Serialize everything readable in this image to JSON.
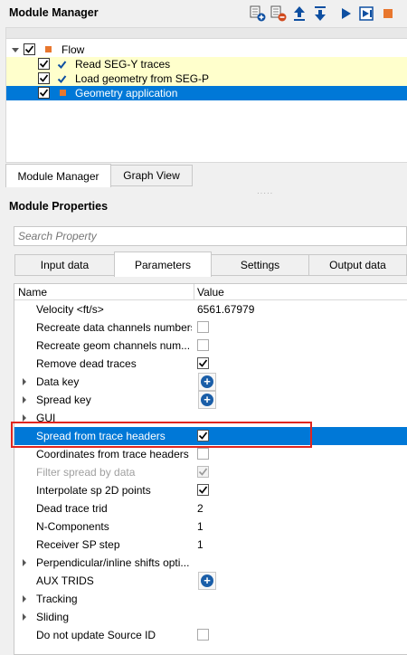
{
  "module_manager": {
    "title": "Module Manager",
    "toolbar": [
      {
        "name": "add-module-icon",
        "color": "#0e4fa1"
      },
      {
        "name": "remove-module-icon",
        "color": "#d04a1e"
      },
      {
        "name": "move-up-icon",
        "color": "#0e4fa1"
      },
      {
        "name": "move-down-icon",
        "color": "#0e4fa1"
      },
      {
        "name": "run-icon",
        "color": "#0e4fa1"
      },
      {
        "name": "step-run-icon",
        "color": "#0e4fa1"
      },
      {
        "name": "stop-icon",
        "color": "#e8772e"
      }
    ]
  },
  "flow": {
    "root": {
      "label": "Flow",
      "checked": true
    },
    "items": [
      {
        "label": "Read SEG-Y traces",
        "checked": true,
        "status": "done"
      },
      {
        "label": "Load geometry from SEG-P",
        "checked": true,
        "status": "done"
      },
      {
        "label": "Geometry application",
        "checked": true,
        "status": "pending",
        "selected": true
      }
    ]
  },
  "view_tabs": [
    {
      "label": "Module Manager",
      "active": true
    },
    {
      "label": "Graph View",
      "active": false
    }
  ],
  "module_properties": {
    "title": "Module Properties",
    "search_placeholder": "Search Property",
    "tabs": [
      {
        "label": "Input data",
        "active": false
      },
      {
        "label": "Parameters",
        "active": true
      },
      {
        "label": "Settings",
        "active": false
      },
      {
        "label": "Output data",
        "active": false
      }
    ],
    "columns": {
      "name": "Name",
      "value": "Value"
    },
    "rows": [
      {
        "name": "Velocity <ft/s>",
        "type": "text",
        "value": "6561.67979"
      },
      {
        "name": "Recreate data channels numbers",
        "type": "check",
        "checked": false
      },
      {
        "name": "Recreate geom channels num...",
        "type": "check",
        "checked": false
      },
      {
        "name": "Remove dead traces",
        "type": "check",
        "checked": true
      },
      {
        "name": "Data key",
        "type": "plus",
        "expandable": true
      },
      {
        "name": "Spread key",
        "type": "plus",
        "expandable": true
      },
      {
        "name": "GUI",
        "type": "none",
        "expandable": true
      },
      {
        "name": "Spread from trace headers",
        "type": "check",
        "checked": true,
        "selected": true
      },
      {
        "name": "Coordinates from trace headers",
        "type": "check",
        "checked": false
      },
      {
        "name": "Filter spread by data",
        "type": "check",
        "checked": true,
        "disabled": true
      },
      {
        "name": "Interpolate sp 2D points",
        "type": "check",
        "checked": true
      },
      {
        "name": "Dead trace trid",
        "type": "text",
        "value": "2"
      },
      {
        "name": "N-Components",
        "type": "text",
        "value": "1"
      },
      {
        "name": "Receiver SP step",
        "type": "text",
        "value": "1"
      },
      {
        "name": "Perpendicular/inline shifts opti...",
        "type": "none",
        "expandable": true
      },
      {
        "name": "AUX TRIDS",
        "type": "plus"
      },
      {
        "name": "Tracking",
        "type": "none",
        "expandable": true
      },
      {
        "name": "Sliding",
        "type": "none",
        "expandable": true
      },
      {
        "name": "Do not update Source ID",
        "type": "check",
        "checked": false
      }
    ]
  },
  "colors": {
    "selection": "#0078d7",
    "pending_row": "#ffffcc",
    "highlight_border": "#e0261f",
    "status_done": "#0e4fa1",
    "status_pending": "#e8772e"
  }
}
